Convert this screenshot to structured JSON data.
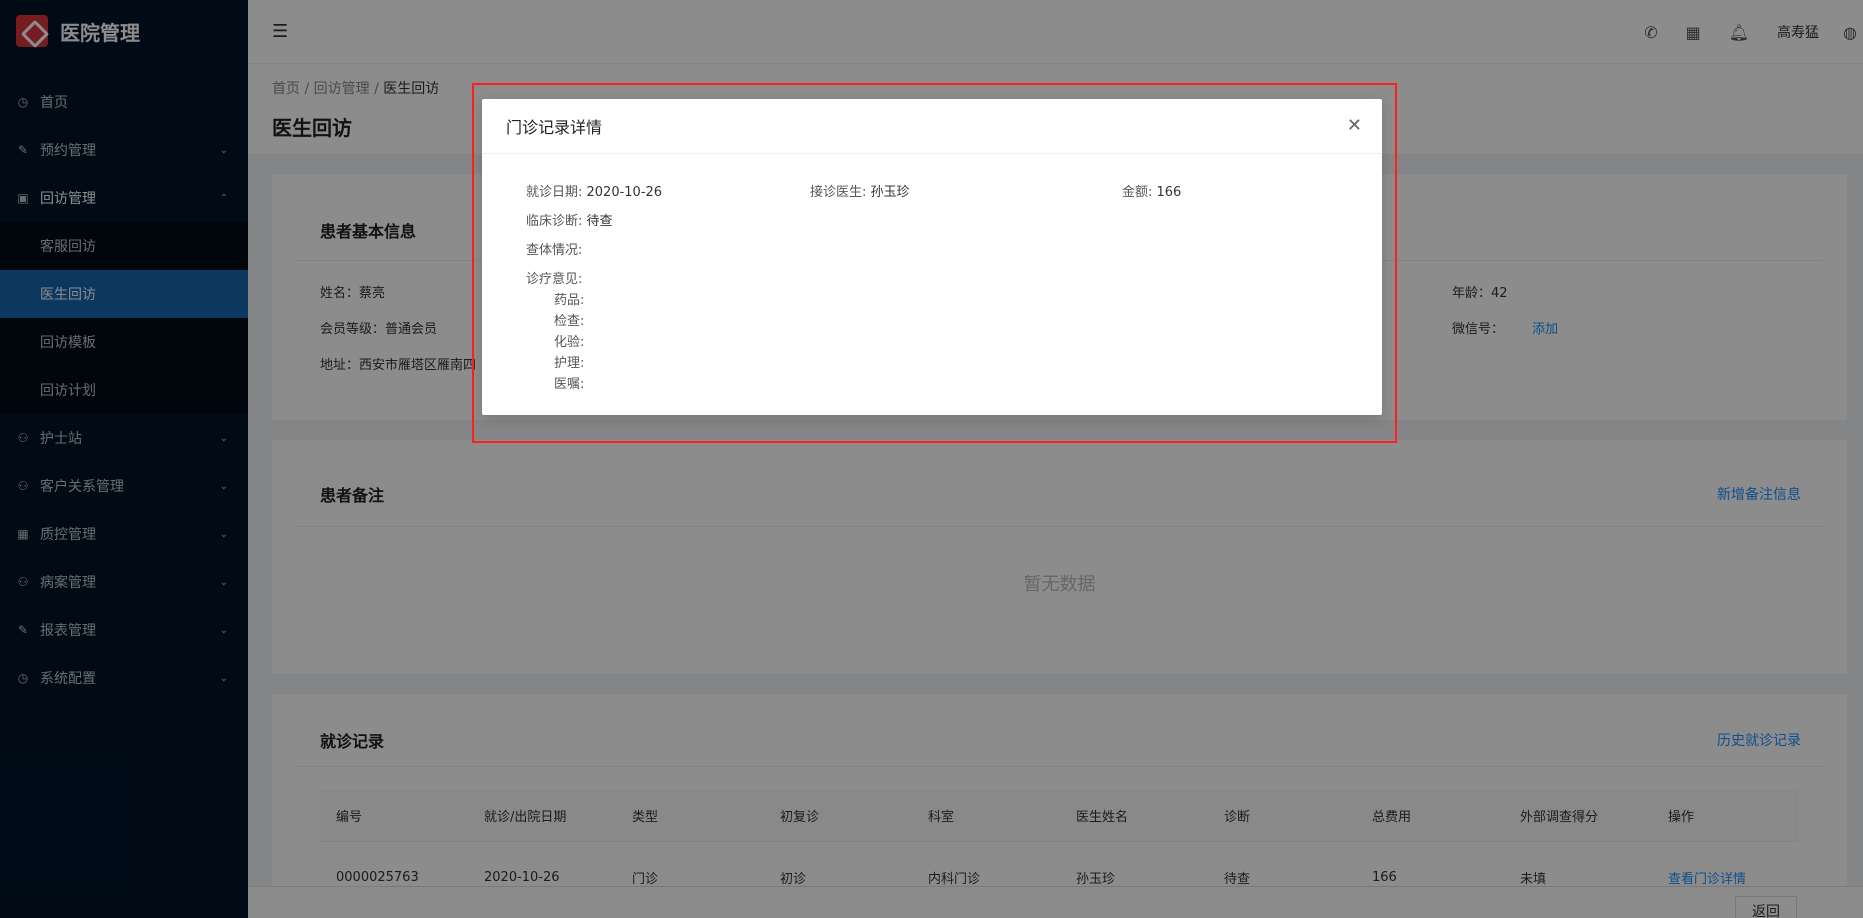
{
  "app": {
    "title": "医院管理"
  },
  "sidebar": {
    "items": [
      {
        "label": "首页",
        "icon": "dashboard-icon"
      },
      {
        "label": "预约管理",
        "icon": "edit-icon"
      },
      {
        "label": "回访管理",
        "icon": "lock-icon"
      },
      {
        "label": "护士站",
        "icon": "user-icon"
      },
      {
        "label": "客户关系管理",
        "icon": "user-icon"
      },
      {
        "label": "质控管理",
        "icon": "table-icon"
      },
      {
        "label": "病案管理",
        "icon": "user-icon"
      },
      {
        "label": "报表管理",
        "icon": "edit-icon"
      },
      {
        "label": "系统配置",
        "icon": "dashboard-icon"
      }
    ],
    "sub": [
      {
        "label": "客服回访"
      },
      {
        "label": "医生回访"
      },
      {
        "label": "回访模板"
      },
      {
        "label": "回访计划"
      }
    ]
  },
  "header": {
    "user": "高寿猛"
  },
  "breadcrumb": {
    "home": "首页",
    "parent": "回访管理",
    "current": "医生回访"
  },
  "page": {
    "title": "医生回访"
  },
  "patient": {
    "title": "患者基本信息",
    "name_label": "姓名：",
    "name": "蔡亮",
    "level_label": "会员等级：",
    "level": "普通会员",
    "addr_label": "地址：",
    "addr": "西安市雁塔区雁南四",
    "age_label": "年龄：",
    "age": "42",
    "wechat_label": "微信号：",
    "wechat_add": "添加"
  },
  "notes": {
    "title": "患者备注",
    "add_link": "新增备注信息",
    "empty": "暂无数据"
  },
  "visits": {
    "title": "就诊记录",
    "history_link": "历史就诊记录",
    "columns": [
      "编号",
      "就诊/出院日期",
      "类型",
      "初复诊",
      "科室",
      "医生姓名",
      "诊断",
      "总费用",
      "外部调查得分",
      "操作"
    ],
    "row": [
      "0000025763",
      "2020-10-26",
      "门诊",
      "初诊",
      "内科门诊",
      "孙玉珍",
      "待查",
      "166",
      "未填",
      "查看门诊详情"
    ]
  },
  "footer": {
    "back": "返回"
  },
  "modal": {
    "title": "门诊记录详情",
    "date_label": "就诊日期: ",
    "date": "2020-10-26",
    "doctor_label": "接诊医生: ",
    "doctor": "孙玉珍",
    "amount_label": "金额: ",
    "amount": "166",
    "diag_label": "临床诊断: ",
    "diag": "待查",
    "exam_label": "查体情况:",
    "opinion_label": "诊疗意见:",
    "drug_label": "药品:",
    "check_label": "检查:",
    "lab_label": "化验:",
    "care_label": "护理:",
    "advice_label": "医嘱:"
  }
}
